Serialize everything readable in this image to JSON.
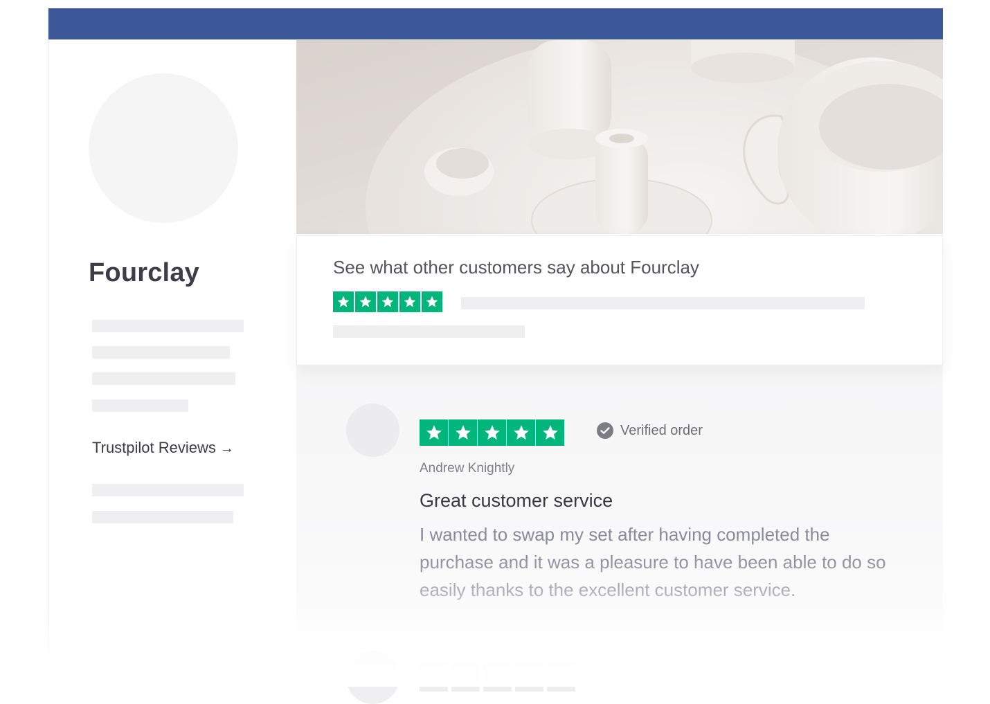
{
  "header": {
    "bar_color": "#3b5998"
  },
  "sidebar": {
    "title": "Fourclay",
    "reviews_link": {
      "label": "Trustpilot Reviews",
      "arrow": "→"
    }
  },
  "cover_image": {
    "description_icon": "ceramics-photo"
  },
  "summary": {
    "heading": "See what other customers say about Fourclay",
    "rating_stars": 5,
    "star_color": "#00b67a"
  },
  "review": {
    "rating_stars": 5,
    "verified_label": "Verified order",
    "reviewer_name": "Andrew Knightly",
    "title": "Great customer service",
    "body": "I wanted to swap my set after having completed the purchase and it was a pleasure to have been able to do so easily thanks to the excellent customer service."
  }
}
